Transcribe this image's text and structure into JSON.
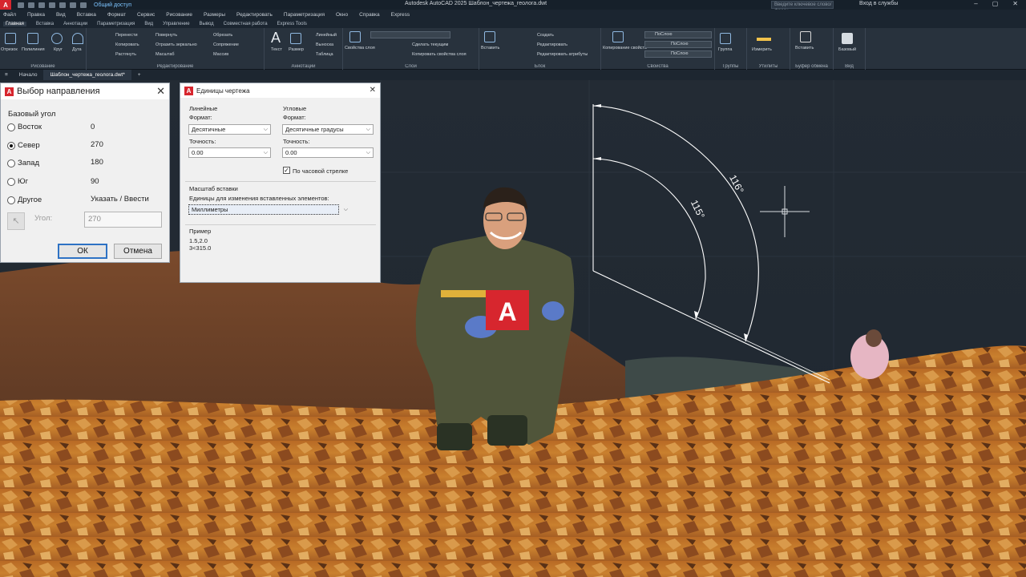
{
  "app": {
    "title": "Autodesk AutoCAD 2025   Шаблон_чертежа_геолога.dwt",
    "share": "Общий доступ",
    "search_placeholder": "Введите ключевое слово/фразу",
    "signin": "Вход в службы",
    "window_controls": [
      "–",
      "▢",
      "✕"
    ]
  },
  "menubar": [
    "Файл",
    "Правка",
    "Вид",
    "Вставка",
    "Формат",
    "Сервис",
    "Рисование",
    "Размеры",
    "Редактировать",
    "Параметризация",
    "Окно",
    "Справка",
    "Express"
  ],
  "ribbon_tabs": [
    "Главная",
    "Вставка",
    "Аннотации",
    "Параметризация",
    "Вид",
    "Управление",
    "Вывод",
    "Совместная работа",
    "Express Tools"
  ],
  "ribbon": {
    "draw": {
      "title": "Рисование",
      "tools": [
        "Отрезок",
        "Полилиния",
        "Круг",
        "Дуга"
      ]
    },
    "modify": {
      "title": "Редактирование",
      "tools": [
        "Перенести",
        "Повернуть",
        "Обрезать",
        "Копировать",
        "Отразить зеркально",
        "Сопряжение",
        "Растянуть",
        "Масштаб",
        "Массив"
      ]
    },
    "annotation": {
      "title": "Аннотации",
      "tools": [
        "Текст",
        "Размер",
        "Линейный",
        "Выноска",
        "Таблица"
      ]
    },
    "layers": {
      "title": "Слои",
      "tools": [
        "Свойства слоя",
        "Сделать текущим",
        "Копировать свойства слоя"
      ]
    },
    "block": {
      "title": "Блок",
      "tools": [
        "Вставить",
        "Создать",
        "Редактировать",
        "Редактировать атрибуты"
      ]
    },
    "properties": {
      "title": "Свойства",
      "tools": [
        "Копирование свойств",
        "ПоСлою",
        "ПоСлою",
        "ПоСлою"
      ]
    },
    "groups": {
      "title": "Группы",
      "tools": [
        "Группа"
      ]
    },
    "utilities": {
      "title": "Утилиты",
      "tools": [
        "Измерить"
      ]
    },
    "clipboard": {
      "title": "Буфер обмена",
      "tools": [
        "Вставить"
      ]
    },
    "view": {
      "title": "Вид",
      "tools": [
        "Базовый"
      ]
    }
  },
  "file_tabs": [
    {
      "label": "Начало",
      "active": false
    },
    {
      "label": "Шаблон_чертежа_геолога.dwt*",
      "active": true
    }
  ],
  "direction_dialog": {
    "title": "Выбор направления",
    "group": "Базовый угол",
    "options": [
      {
        "label": "Восток",
        "value": "0",
        "selected": false
      },
      {
        "label": "Север",
        "value": "270",
        "selected": true
      },
      {
        "label": "Запад",
        "value": "180",
        "selected": false
      },
      {
        "label": "Юг",
        "value": "90",
        "selected": false
      },
      {
        "label": "Другое",
        "value": "Указать / Ввести",
        "selected": false
      }
    ],
    "angle_label": "Угол:",
    "angle_value": "270",
    "ok": "ОК",
    "cancel": "Отмена"
  },
  "units_dialog": {
    "title": "Единицы чертежа",
    "linear": {
      "group": "Линейные",
      "format_label": "Формат:",
      "format_value": "Десятичные",
      "precision_label": "Точность:",
      "precision_value": "0.00"
    },
    "angular": {
      "group": "Угловые",
      "format_label": "Формат:",
      "format_value": "Десятичные градусы",
      "precision_label": "Точность:",
      "precision_value": "0.00",
      "clockwise_label": "По часовой стрелке",
      "clockwise": true
    },
    "insertion": {
      "group": "Масштаб вставки",
      "label": "Единицы для изменения вставленных элементов:",
      "value": "Миллиметры"
    },
    "sample": {
      "group": "Пример",
      "line1": "1.5,2.0",
      "line2": "3<315.0"
    }
  },
  "drawing": {
    "dim_outer": "116°",
    "dim_inner": "115°",
    "logo_letter": "A"
  },
  "colors": {
    "canvas": "#212830",
    "ribbon": "#28323d",
    "brand_red": "#d7262e",
    "dim_line": "#ffffff"
  }
}
